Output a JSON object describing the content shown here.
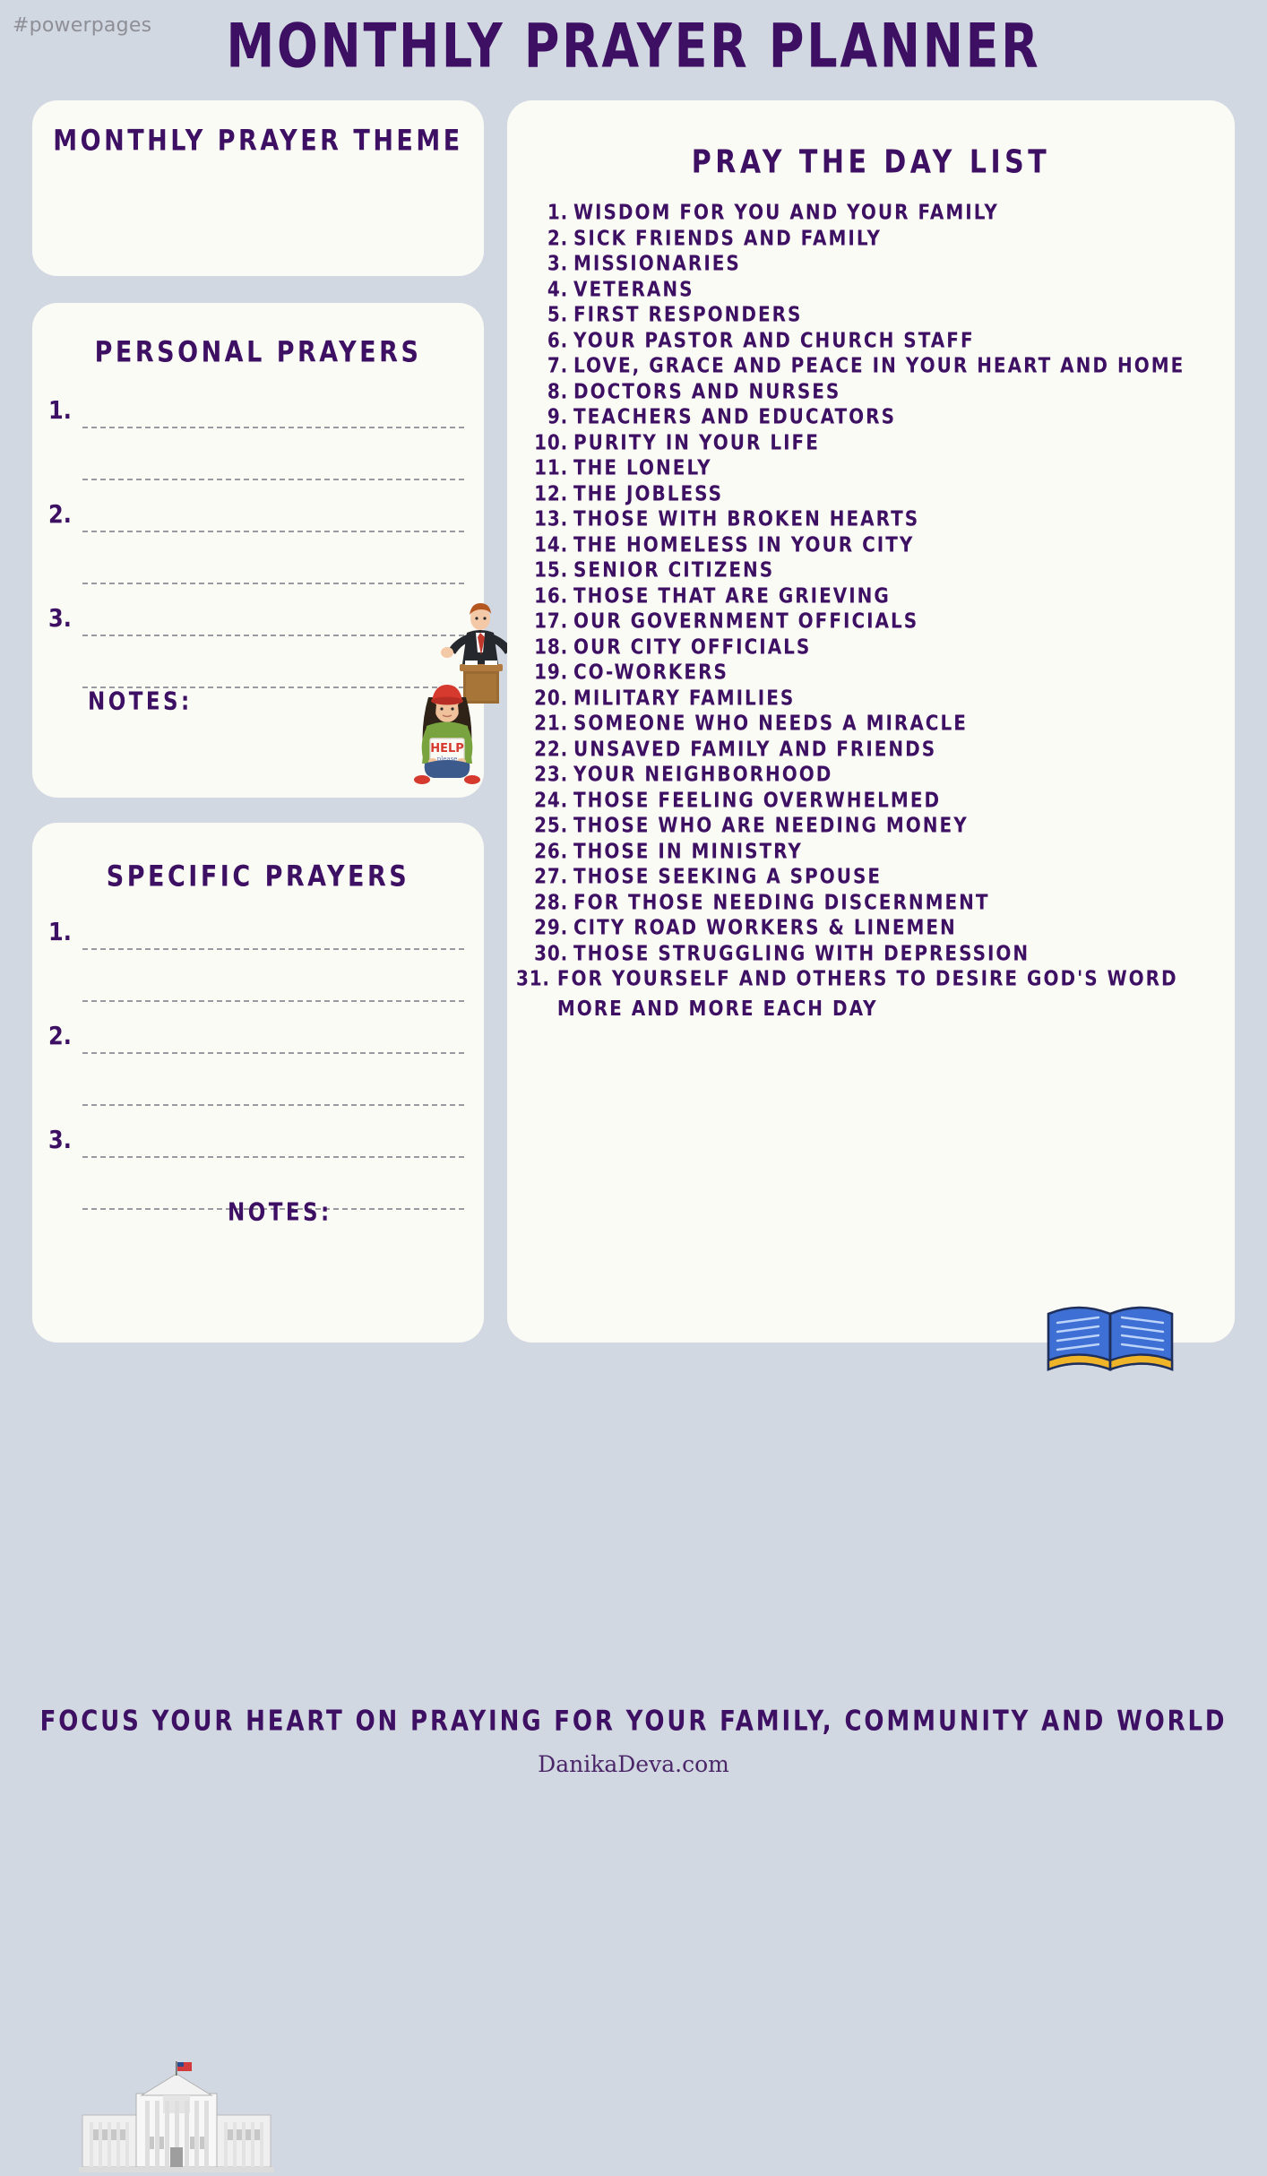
{
  "watermark": "#powerpages",
  "page_title": "MONTHLY PRAYER PLANNER",
  "colors": {
    "page_background": "#d2d8e2",
    "card_background": "#fbfbf5",
    "ink": "#3d1063",
    "dashed_line": "#9a9aa0"
  },
  "cards": {
    "theme": {
      "title": "MONTHLY PRAYER THEME"
    },
    "personal": {
      "title": "PERSONAL PRAYERS",
      "numbers": [
        "1.",
        "2.",
        "3."
      ],
      "notes_label": "NOTES:"
    },
    "specific": {
      "title": "SPECIFIC PRAYERS",
      "numbers": [
        "1.",
        "2.",
        "3."
      ],
      "notes_label": "NOTES:"
    },
    "daylist": {
      "title": "PRAY THE DAY LIST",
      "items": [
        {
          "num": "1.",
          "text": "WISDOM FOR YOU AND YOUR FAMILY"
        },
        {
          "num": "2.",
          "text": "SICK FRIENDS AND FAMILY"
        },
        {
          "num": "3.",
          "text": "MISSIONARIES"
        },
        {
          "num": "4.",
          "text": "VETERANS"
        },
        {
          "num": "5.",
          "text": "FIRST RESPONDERS"
        },
        {
          "num": "6.",
          "text": "YOUR PASTOR AND CHURCH STAFF"
        },
        {
          "num": "7.",
          "text": "LOVE, GRACE AND PEACE IN YOUR HEART AND HOME"
        },
        {
          "num": "8.",
          "text": "DOCTORS AND NURSES"
        },
        {
          "num": "9.",
          "text": "TEACHERS AND EDUCATORS"
        },
        {
          "num": "10.",
          "text": "PURITY IN YOUR LIFE"
        },
        {
          "num": "11.",
          "text": "THE LONELY"
        },
        {
          "num": "12.",
          "text": "THE JOBLESS"
        },
        {
          "num": "13.",
          "text": "THOSE WITH BROKEN HEARTS"
        },
        {
          "num": "14.",
          "text": "THE HOMELESS IN YOUR CITY"
        },
        {
          "num": "15.",
          "text": "SENIOR CITIZENS"
        },
        {
          "num": "16.",
          "text": "THOSE THAT ARE GRIEVING"
        },
        {
          "num": "17.",
          "text": "OUR GOVERNMENT OFFICIALS"
        },
        {
          "num": "18.",
          "text": "OUR CITY OFFICIALS"
        },
        {
          "num": "19.",
          "text": "CO-WORKERS"
        },
        {
          "num": "20.",
          "text": "MILITARY FAMILIES"
        },
        {
          "num": "21.",
          "text": "SOMEONE WHO NEEDS A MIRACLE"
        },
        {
          "num": "22.",
          "text": "UNSAVED FAMILY AND FRIENDS"
        },
        {
          "num": "23.",
          "text": "YOUR NEIGHBORHOOD"
        },
        {
          "num": "24.",
          "text": "THOSE FEELING OVERWHELMED"
        },
        {
          "num": "25.",
          "text": "THOSE WHO ARE NEEDING MONEY"
        },
        {
          "num": "26.",
          "text": "THOSE IN MINISTRY"
        },
        {
          "num": "27.",
          "text": "THOSE SEEKING A SPOUSE"
        },
        {
          "num": "28.",
          "text": "FOR THOSE NEEDING DISCERNMENT"
        },
        {
          "num": "29.",
          "text": "CITY ROAD WORKERS & LINEMEN"
        },
        {
          "num": "30.",
          "text": "THOSE STRUGGLING WITH DEPRESSION"
        },
        {
          "num": "31.",
          "text": "FOR YOURSELF AND OTHERS TO DESIRE GOD'S WORD MORE AND MORE EACH DAY"
        }
      ]
    }
  },
  "illustrations": [
    {
      "name": "speaker-at-podium-illustration"
    },
    {
      "name": "help-sign-girl-illustration"
    },
    {
      "name": "white-house-illustration"
    },
    {
      "name": "ambulance-illustration"
    },
    {
      "name": "bandaged-heart-illustration"
    },
    {
      "name": "senior-couple-illustration"
    },
    {
      "name": "soldier-illustration"
    },
    {
      "name": "wedding-rings-illustration"
    },
    {
      "name": "open-book-illustration"
    }
  ],
  "footer": {
    "tagline": "FOCUS YOUR HEART ON PRAYING FOR YOUR FAMILY, COMMUNITY AND WORLD",
    "site": "DanikaDeva.com"
  }
}
